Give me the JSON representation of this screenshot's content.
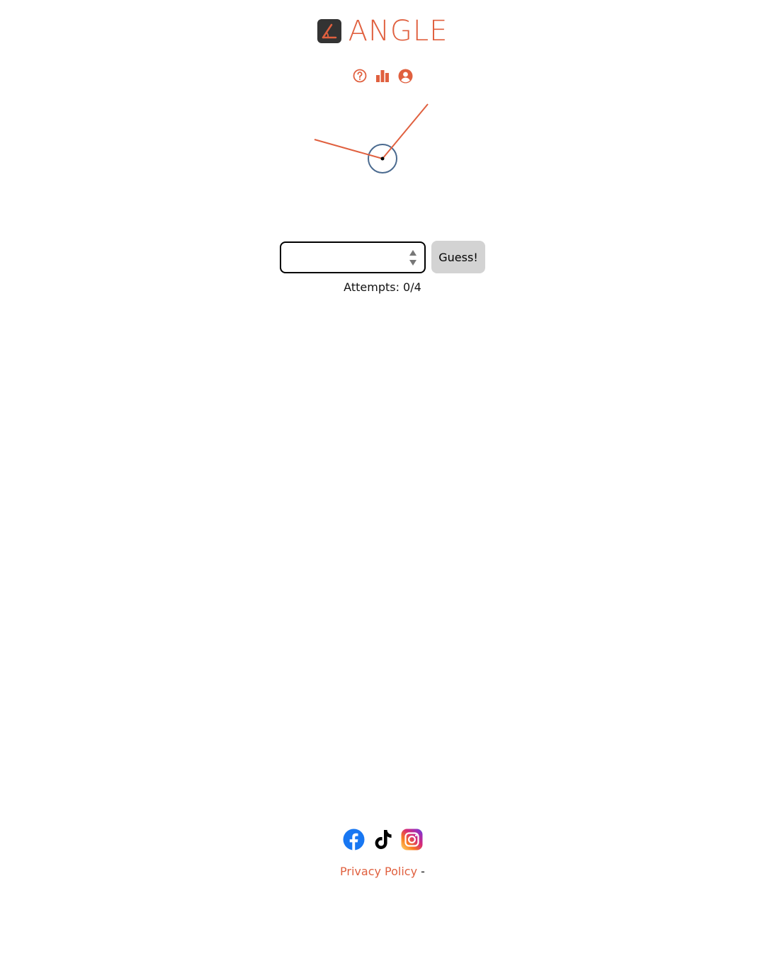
{
  "app": {
    "title": "ANGLE",
    "logo_icon": "angle-logo-icon"
  },
  "colors": {
    "accent": "#e0603f",
    "logo_bg": "#333333",
    "arc": "#4a6a8f",
    "button_bg": "#d3d3d3"
  },
  "toolbar": {
    "items": [
      {
        "icon": "help-circle-icon"
      },
      {
        "icon": "bar-chart-icon"
      },
      {
        "icon": "user-circle-icon"
      }
    ]
  },
  "puzzle": {
    "ray_a_direction_deg": 165,
    "ray_b_direction_deg": 51,
    "arc_shape": "reflex-circle-marker"
  },
  "guess": {
    "input_value": "",
    "input_placeholder": "",
    "button_label": "Guess!"
  },
  "attempts": {
    "text": "Attempts: 0/4",
    "used": 0,
    "max": 4
  },
  "footer": {
    "socials": [
      {
        "icon": "facebook-icon"
      },
      {
        "icon": "tiktok-icon"
      },
      {
        "icon": "instagram-icon"
      }
    ],
    "privacy_label": "Privacy Policy",
    "separator": "-"
  }
}
